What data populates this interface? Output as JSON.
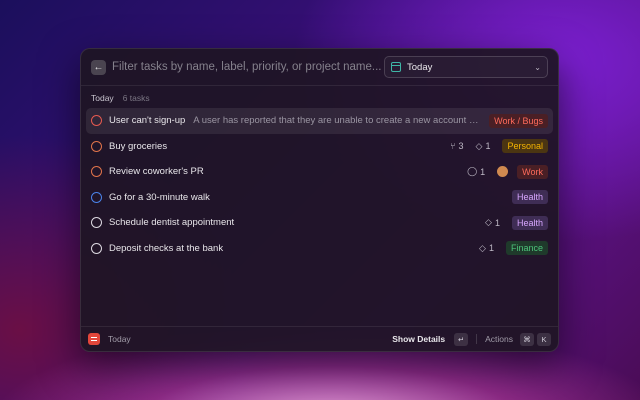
{
  "search": {
    "placeholder": "Filter tasks by name, label, priority, or project name..."
  },
  "filter": {
    "label": "Today"
  },
  "section": {
    "title": "Today",
    "count": "6 tasks"
  },
  "tasks": [
    {
      "title": "User can't sign-up",
      "description": "A user has reported that they are unable to create a new account on th...",
      "tag": "Work / Bugs",
      "tag_color": "#ff6b5b",
      "tag_bg": "#4a1f25",
      "circle_color": "#e5594f",
      "selected": true
    },
    {
      "title": "Buy groceries",
      "subtasks": "3",
      "labels": "1",
      "tag": "Personal",
      "tag_color": "#f5b400",
      "tag_bg": "#4b3512",
      "circle_color": "#e0734a"
    },
    {
      "title": "Review coworker's PR",
      "comments": "1",
      "tag": "Work",
      "tag_color": "#ff6b5b",
      "tag_bg": "#4a1f25",
      "circle_color": "#e0734a"
    },
    {
      "title": "Go for a 30-minute walk",
      "tag": "Health",
      "tag_color": "#d7a6ff",
      "tag_bg": "#3f2d55",
      "circle_color": "#4a82e8"
    },
    {
      "title": "Schedule dentist appointment",
      "labels": "1",
      "tag": "Health",
      "tag_color": "#d7a6ff",
      "tag_bg": "#3f2d55",
      "circle_color": "#dcd8e0"
    },
    {
      "title": "Deposit checks at the bank",
      "labels": "1",
      "tag": "Finance",
      "tag_color": "#4cc27a",
      "tag_bg": "#1f3a2b",
      "circle_color": "#dcd8e0"
    }
  ],
  "footer": {
    "label": "Today",
    "show_details": "Show Details",
    "enter_key": "↵",
    "actions": "Actions",
    "cmd_key": "⌘",
    "k_key": "K"
  }
}
